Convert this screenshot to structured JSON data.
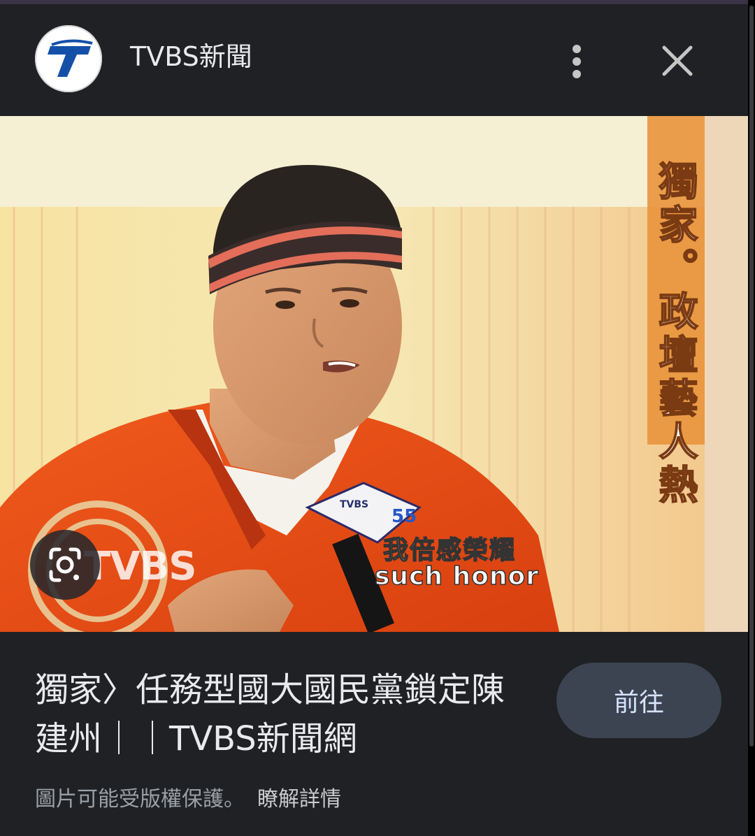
{
  "header": {
    "source_name": "TVBS新聞",
    "logo_letter": "T",
    "more_icon": "more-vert-icon",
    "close_icon": "close-icon"
  },
  "image": {
    "vertical_caption": "獨家。政壇藝人熱",
    "subtitle_zh": "我倍感榮耀",
    "subtitle_en": "such honor",
    "watermark": "TVBS",
    "mic_brand": "TVBS",
    "mic_number": "55",
    "lens_icon": "google-lens-icon"
  },
  "result": {
    "title": "獨家〉任務型國大國民黨鎖定陳建州｜｜TVBS新聞網",
    "visit_button": "前往"
  },
  "footer": {
    "copyright_note": "圖片可能受版權保護。",
    "learn_more": "瞭解詳情"
  },
  "colors": {
    "background": "#202124",
    "button_bg": "#3c4452",
    "button_text": "#d6e3ff",
    "logo_blue": "#1550a8"
  }
}
